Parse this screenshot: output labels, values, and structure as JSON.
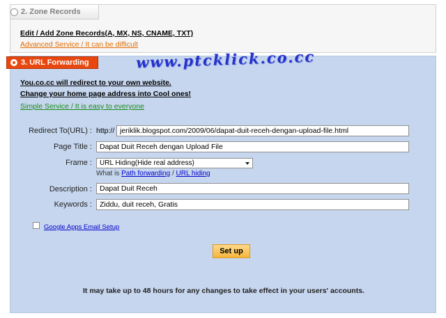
{
  "zone": {
    "tab_label": "2. Zone Records",
    "edit_link": "Edit / Add Zone Records(A, MX, NS, CNAME, TXT)",
    "advanced_link": "Advanced Service / It can be difficult"
  },
  "url": {
    "tab_label": "3. URL Forwarding",
    "line1": "You.co.cc will redirect to your own website.",
    "line2": "Change your home page address into Cool ones!",
    "simple_link": "Simple Service / It is easy to everyone"
  },
  "watermark": "www.ptcklick.co.cc",
  "form": {
    "redirect_label": "Redirect To(URL) :",
    "redirect_prefix": "http://",
    "redirect_value": "jeriklik.blogspot.com/2009/06/dapat-duit-receh-dengan-upload-file.html",
    "title_label": "Page Title :",
    "title_value": "Dapat Duit Receh dengan Upload File",
    "frame_label": "Frame :",
    "frame_value": "URL Hiding(Hide real address)",
    "frame_help_prefix": "What is",
    "frame_help_path": "Path forwarding",
    "frame_help_sep": "/",
    "frame_help_url": "URL hiding",
    "description_label": "Description :",
    "description_value": "Dapat Duit Receh",
    "keywords_label": "Keywords :",
    "keywords_value": "Ziddu, duit receh, Gratis",
    "google_label": "Google Apps Email Setup",
    "setup_label": "Set up",
    "notice": "It may take up to 48 hours for any changes to take effect in your users' accounts."
  },
  "colors": {
    "active_tab": "#e8470f",
    "panel_bg": "#c6d6ee",
    "button": "#f6b53c",
    "watermark": "#2533c8"
  }
}
